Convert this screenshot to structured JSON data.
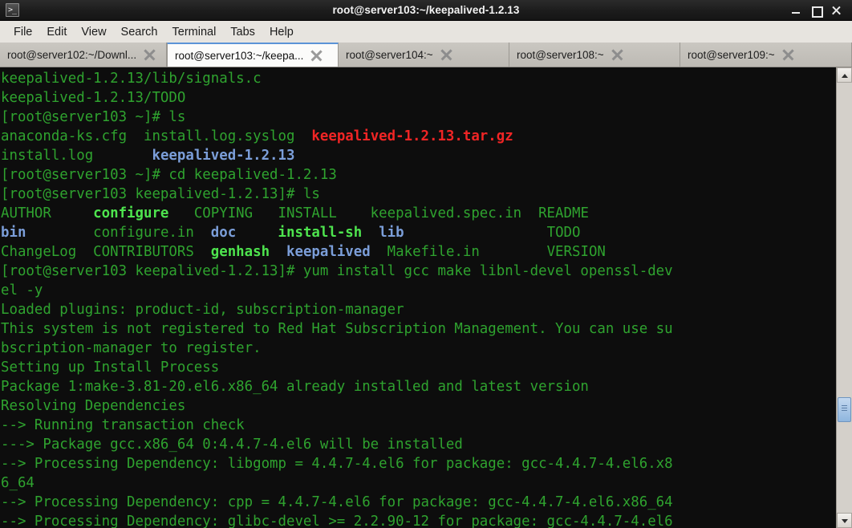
{
  "window": {
    "title": "root@server103:~/keepalived-1.2.13",
    "app_icon": "terminal-icon",
    "controls": {
      "minimize": "minimize-button",
      "maximize": "maximize-button",
      "close": "close-button"
    }
  },
  "menubar": {
    "items": [
      "File",
      "Edit",
      "View",
      "Search",
      "Terminal",
      "Tabs",
      "Help"
    ]
  },
  "tabs": [
    {
      "label": "root@server102:~/Downl...",
      "active": false
    },
    {
      "label": "root@server103:~/keepa...",
      "active": true
    },
    {
      "label": "root@server104:~",
      "active": false
    },
    {
      "label": "root@server108:~",
      "active": false
    },
    {
      "label": "root@server109:~",
      "active": false
    }
  ],
  "colors": {
    "background": "#0d0d0d",
    "foreground_green": "#2fa32f",
    "bright_green": "#4ee44e",
    "directory_blue": "#7b9ed9",
    "archive_red": "#f02525",
    "tab_accent": "#5b93d6"
  },
  "terminal": {
    "lines": [
      [
        {
          "t": "keepalived-1.2.13/lib/signals.c",
          "c": "g"
        }
      ],
      [
        {
          "t": "keepalived-1.2.13/TODO",
          "c": "g"
        }
      ],
      [
        {
          "t": "[root@server103 ~]# ls",
          "c": "g"
        }
      ],
      [
        {
          "t": "anaconda-ks.cfg  install.log.syslog  ",
          "c": "g"
        },
        {
          "t": "keepalived-1.2.13.tar.gz",
          "c": "rd"
        }
      ],
      [
        {
          "t": "install.log       ",
          "c": "g"
        },
        {
          "t": "keepalived-1.2.13",
          "c": "bl"
        }
      ],
      [
        {
          "t": "[root@server103 ~]# cd keepalived-1.2.13",
          "c": "g"
        }
      ],
      [
        {
          "t": "[root@server103 keepalived-1.2.13]# ls",
          "c": "g"
        }
      ],
      [
        {
          "t": "AUTHOR     ",
          "c": "g"
        },
        {
          "t": "configure",
          "c": "bg"
        },
        {
          "t": "   COPYING   INSTALL    keepalived.spec.in  README",
          "c": "g"
        }
      ],
      [
        {
          "t": "bin",
          "c": "bl"
        },
        {
          "t": "        configure.in  ",
          "c": "g"
        },
        {
          "t": "doc",
          "c": "bl"
        },
        {
          "t": "     ",
          "c": "g"
        },
        {
          "t": "install-sh",
          "c": "bg"
        },
        {
          "t": "  ",
          "c": "g"
        },
        {
          "t": "lib",
          "c": "bl"
        },
        {
          "t": "                 TODO",
          "c": "g"
        }
      ],
      [
        {
          "t": "ChangeLog  CONTRIBUTORS  ",
          "c": "g"
        },
        {
          "t": "genhash",
          "c": "bg"
        },
        {
          "t": "  ",
          "c": "g"
        },
        {
          "t": "keepalived",
          "c": "bl"
        },
        {
          "t": "  Makefile.in        VERSION",
          "c": "g"
        }
      ],
      [
        {
          "t": "[root@server103 keepalived-1.2.13]# yum install gcc make libnl-devel openssl-dev",
          "c": "g"
        }
      ],
      [
        {
          "t": "el -y",
          "c": "g"
        }
      ],
      [
        {
          "t": "Loaded plugins: product-id, subscription-manager",
          "c": "g"
        }
      ],
      [
        {
          "t": "This system is not registered to Red Hat Subscription Management. You can use su",
          "c": "g"
        }
      ],
      [
        {
          "t": "bscription-manager to register.",
          "c": "g"
        }
      ],
      [
        {
          "t": "Setting up Install Process",
          "c": "g"
        }
      ],
      [
        {
          "t": "Package 1:make-3.81-20.el6.x86_64 already installed and latest version",
          "c": "g"
        }
      ],
      [
        {
          "t": "Resolving Dependencies",
          "c": "g"
        }
      ],
      [
        {
          "t": "--> Running transaction check",
          "c": "g"
        }
      ],
      [
        {
          "t": "---> Package gcc.x86_64 0:4.4.7-4.el6 will be installed",
          "c": "g"
        }
      ],
      [
        {
          "t": "--> Processing Dependency: libgomp = 4.4.7-4.el6 for package: gcc-4.4.7-4.el6.x8",
          "c": "g"
        }
      ],
      [
        {
          "t": "6_64",
          "c": "g"
        }
      ],
      [
        {
          "t": "--> Processing Dependency: cpp = 4.4.7-4.el6 for package: gcc-4.4.7-4.el6.x86_64",
          "c": "g"
        }
      ],
      [
        {
          "t": "--> Processing Dependency: glibc-devel >= 2.2.90-12 for package: gcc-4.4.7-4.el6",
          "c": "g"
        }
      ]
    ]
  },
  "scrollbar": {
    "up_arrow": "scroll-up-arrow",
    "down_arrow": "scroll-down-arrow",
    "thumb": "scroll-thumb"
  }
}
